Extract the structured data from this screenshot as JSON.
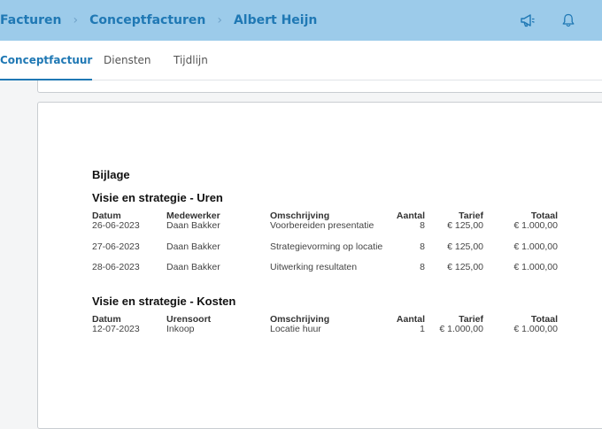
{
  "breadcrumb": [
    "Facturen",
    "Conceptfacturen",
    "Albert Heijn"
  ],
  "header": {
    "icons": [
      "megaphone-icon",
      "bell-icon"
    ]
  },
  "tabs": [
    {
      "label": "Conceptfactuur",
      "active": true
    },
    {
      "label": "Diensten",
      "active": false
    },
    {
      "label": "Tijdlijn",
      "active": false
    }
  ],
  "document": {
    "bijlage": "Bijlage",
    "uren": {
      "title": "Visie en strategie - Uren",
      "headers": [
        "Datum",
        "Medewerker",
        "Omschrijving",
        "Aantal",
        "Tarief",
        "Totaal"
      ],
      "rows": [
        [
          "26-06-2023",
          "Daan Bakker",
          "Voorbereiden presentatie",
          "8",
          "€ 125,00",
          "€ 1.000,00"
        ],
        [
          "27-06-2023",
          "Daan Bakker",
          "Strategievorming op locatie",
          "8",
          "€ 125,00",
          "€ 1.000,00"
        ],
        [
          "28-06-2023",
          "Daan Bakker",
          "Uitwerking resultaten",
          "8",
          "€ 125,00",
          "€ 1.000,00"
        ]
      ]
    },
    "kosten": {
      "title": "Visie en strategie - Kosten",
      "headers": [
        "Datum",
        "Urensoort",
        "Omschrijving",
        "Aantal",
        "Tarief",
        "Totaal"
      ],
      "rows": [
        [
          "12-07-2023",
          "Inkoop",
          "Locatie huur",
          "1",
          "€ 1.000,00",
          "€ 1.000,00"
        ]
      ]
    }
  },
  "colors": {
    "header_bg": "#9ccbea",
    "accent": "#1f78b4"
  }
}
